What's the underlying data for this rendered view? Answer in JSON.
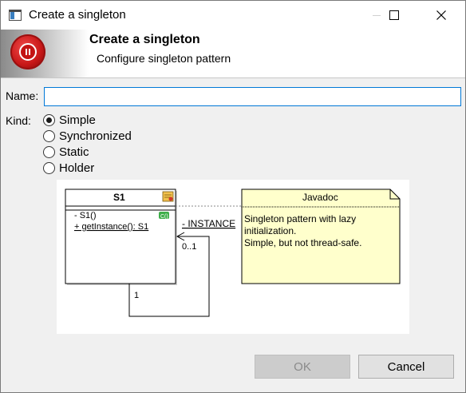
{
  "window": {
    "title": "Create a singleton",
    "controls": [
      "minimize-icon",
      "maximize-icon",
      "close-icon"
    ]
  },
  "banner": {
    "title": "Create a singleton",
    "subtitle": "Configure singleton pattern"
  },
  "form": {
    "name_label": "Name:",
    "name_value": "",
    "kind_label": "Kind:",
    "kinds": [
      {
        "label": "Simple",
        "checked": true
      },
      {
        "label": "Synchronized",
        "checked": false
      },
      {
        "label": "Static",
        "checked": false
      },
      {
        "label": "Holder",
        "checked": false
      }
    ]
  },
  "diagram": {
    "class_name": "S1",
    "constructor": "- S1()",
    "method": "+ getInstance(): S1",
    "assoc_role": "- INSTANCE",
    "mult_many": "0..1",
    "mult_one": "1",
    "note_title": "Javadoc",
    "note_lines": [
      "Singleton pattern with lazy",
      "initialization.",
      "Simple, but not thread-safe."
    ]
  },
  "buttons": {
    "ok": "OK",
    "ok_enabled": false,
    "cancel": "Cancel"
  },
  "colors": {
    "accent": "#0078d7",
    "note_fill": "#ffffcc",
    "logo_red": "#c81818"
  }
}
